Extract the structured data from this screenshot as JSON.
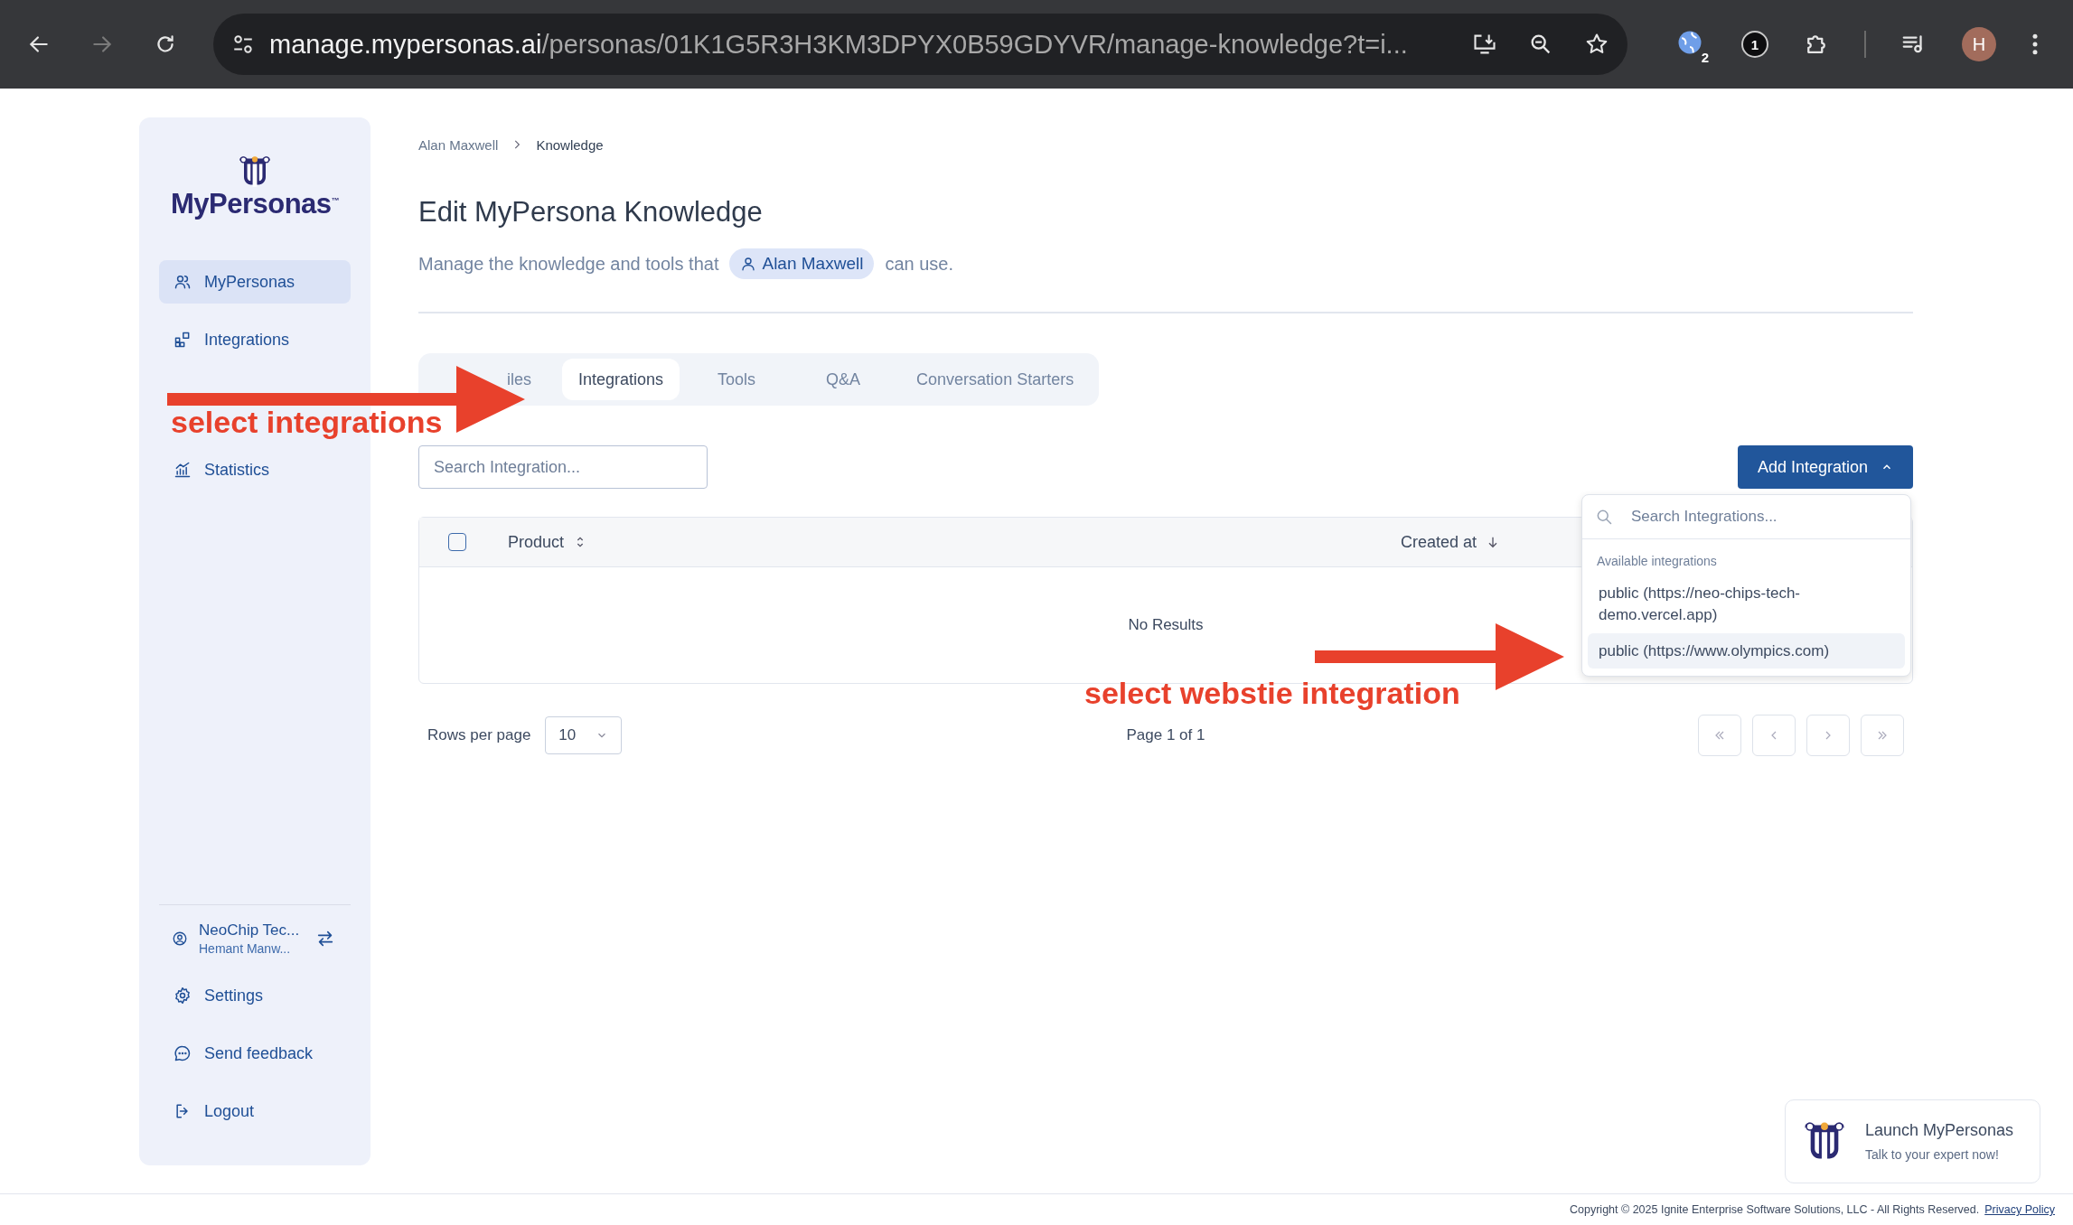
{
  "browser": {
    "url_host": "manage.mypersonas.ai",
    "url_rest": "/personas/01K1G5R3H3KM3DPYX0B59GDYVR/manage-knowledge?t=i...",
    "extension_badge": "2",
    "counter_badge": "1",
    "profile_initial": "H"
  },
  "sidebar": {
    "logo": "MyPersonas$^{™}$",
    "nav": [
      {
        "label": "MyPersonas",
        "selected": true
      },
      {
        "label": "Integrations",
        "selected": false
      },
      {
        "label": "Statistics",
        "selected": false
      }
    ],
    "account": {
      "name": "NeoChip Tec...",
      "user": "Hemant Manw..."
    },
    "bottom": [
      "Settings",
      "Send feedback",
      "Logout"
    ]
  },
  "breadcrumb": [
    "Alan Maxwell",
    "Knowledge"
  ],
  "title": "Edit MyPersona Knowledge",
  "subtitle": {
    "before": "Manage the knowledge and tools that",
    "chip": "Alan Maxwell",
    "after": "can use."
  },
  "tabs": [
    {
      "label": "iles",
      "selected": false
    },
    {
      "label": "Integrations",
      "selected": true
    },
    {
      "label": "Tools",
      "selected": false
    },
    {
      "label": "Q&A",
      "selected": false
    },
    {
      "label": "Conversation Starters",
      "selected": false
    }
  ],
  "search": {
    "placeholder": "Search Integration..."
  },
  "add_button": {
    "label": "Add Integration",
    "expanded": true
  },
  "table": {
    "select_all": {
      "checked": false
    },
    "columns": [
      {
        "label": "Product",
        "sorted": false
      },
      {
        "label": "Created at",
        "sorted": true
      }
    ],
    "empty_text": "No Results"
  },
  "pagination": {
    "rows_label": "Rows per page",
    "rows_value": "10",
    "page_info": "Page 1 of 1"
  },
  "dropdown": {
    "placeholder": "Search Integrations...",
    "group_label": "Available integrations",
    "items": [
      {
        "label": "public (https://neo-chips-tech-demo.vercel.app)",
        "selected": false
      },
      {
        "label": "public (https://www.olympics.com)",
        "selected": true
      }
    ]
  },
  "launch_widget": {
    "title": "Launch MyPersonas",
    "subtitle": "Talk to your expert now!"
  },
  "footer": {
    "copyright": "Copyright © 2025 Ignite Enterprise Software Solutions, LLC - All Rights Reserved.",
    "link": "Privacy Policy"
  },
  "annotations": [
    {
      "text": "select integrations"
    },
    {
      "text": "select webstie integration"
    }
  ]
}
